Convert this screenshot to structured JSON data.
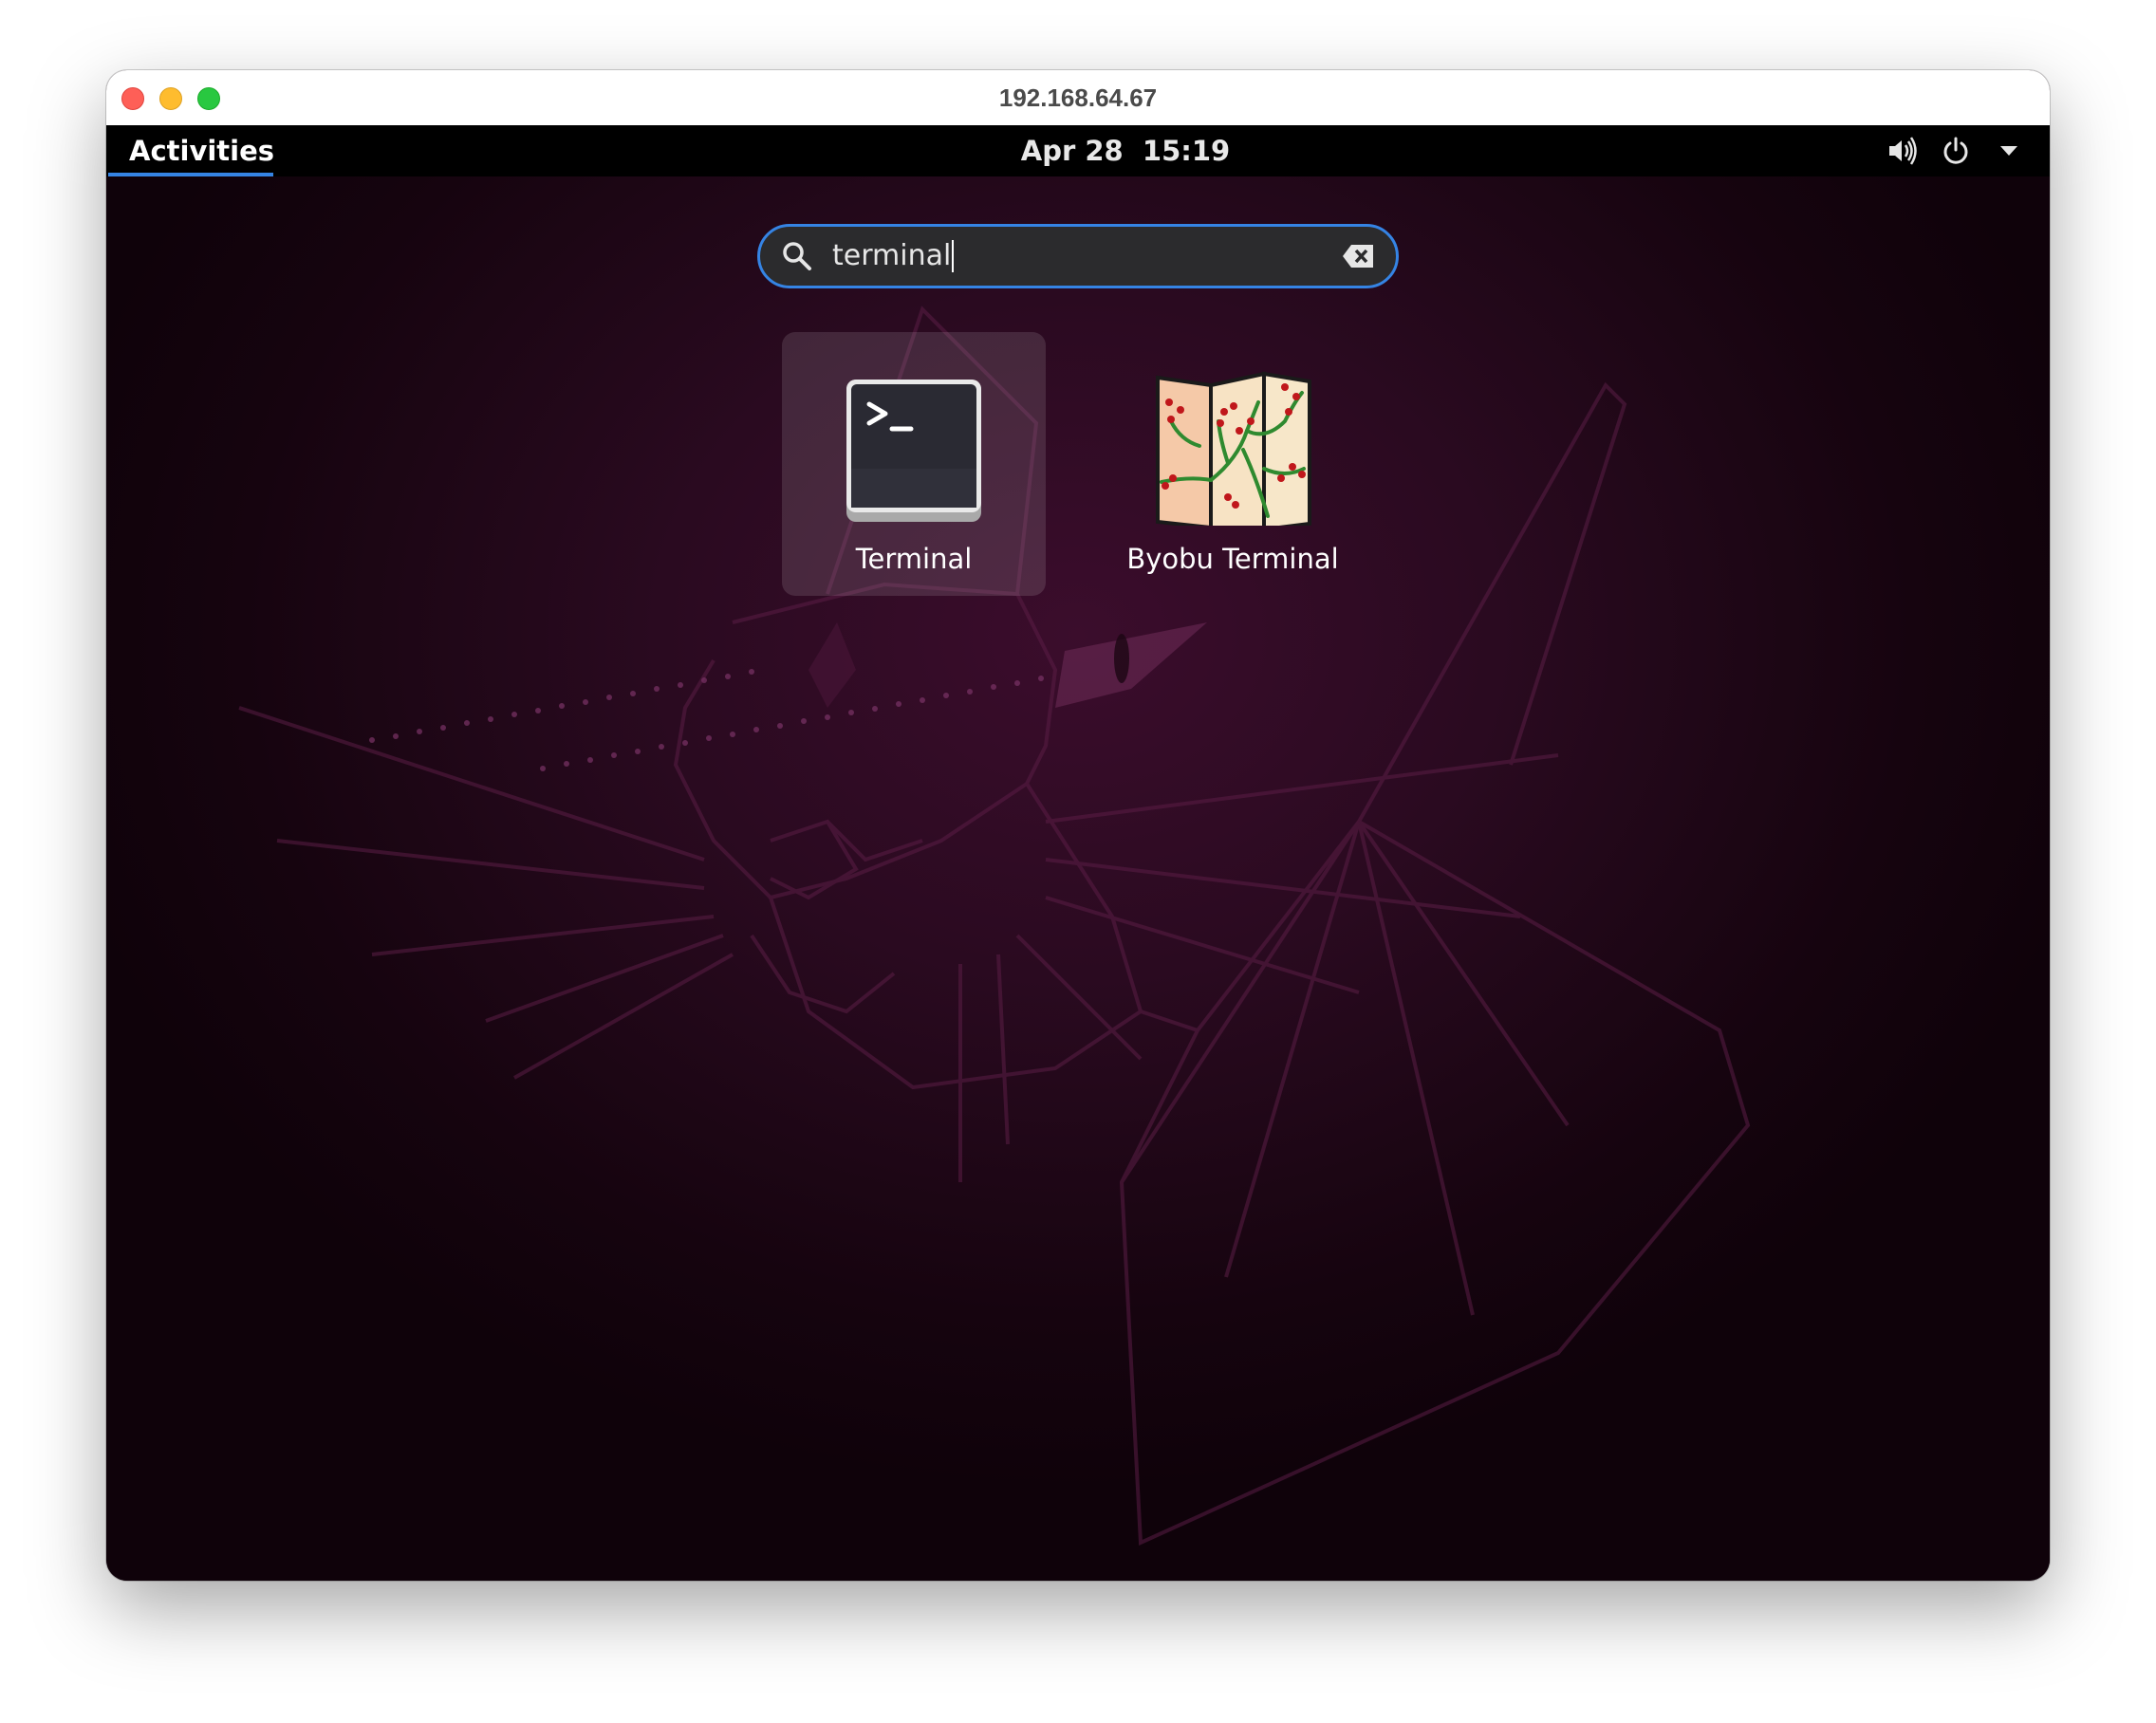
{
  "window": {
    "title": "192.168.64.67"
  },
  "topbar": {
    "activities_label": "Activities",
    "clock": "Apr 28  15:19",
    "tray_icons": [
      "volume-icon",
      "power-icon",
      "dropdown-arrow-icon"
    ]
  },
  "search": {
    "value": "terminal",
    "icons": [
      "search-icon",
      "clear-text-icon"
    ]
  },
  "results": [
    {
      "label": "Terminal",
      "icon": "terminal-app-icon",
      "selected": true
    },
    {
      "label": "Byobu Terminal",
      "icon": "byobu-terminal-app-icon",
      "selected": false
    }
  ],
  "colors": {
    "accent": "#3584e4",
    "topbar": "#000000",
    "wallpaper": "#2c0a22",
    "search_bg": "#2b2b2d"
  }
}
